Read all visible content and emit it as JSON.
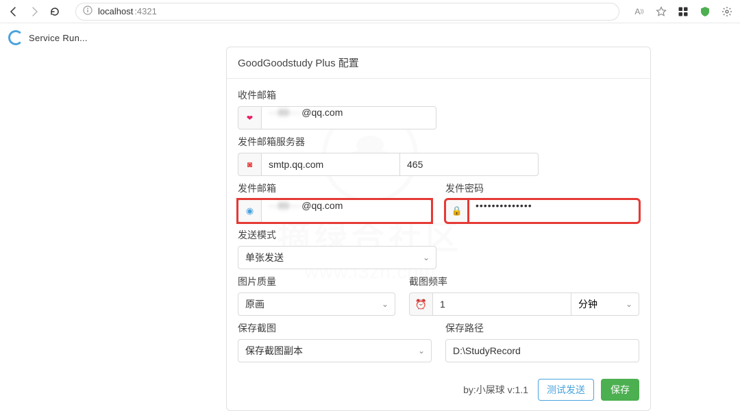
{
  "browser": {
    "url_host": "localhost",
    "url_port": ":4321",
    "tab_title": "Service Run..."
  },
  "card": {
    "title": "GoodGoodstudy Plus 配置",
    "recipient": {
      "label": "收件邮箱",
      "value_prefix": "89",
      "value_suffix": "@qq.com"
    },
    "smtp": {
      "label": "发件邮箱服务器",
      "host": "smtp.qq.com",
      "port": "465"
    },
    "sender": {
      "label": "发件邮箱",
      "value_prefix": "89",
      "value_suffix": "@qq.com"
    },
    "password": {
      "label": "发件密码",
      "value": "••••••••••••••"
    },
    "mode": {
      "label": "发送模式",
      "value": "单张发送"
    },
    "quality": {
      "label": "图片质量",
      "value": "原画"
    },
    "frequency": {
      "label": "截图频率",
      "value": "1",
      "unit": "分钟"
    },
    "keep": {
      "label": "保存截图",
      "value": "保存截图副本"
    },
    "path": {
      "label": "保存路径",
      "value": "D:\\StudyRecord"
    },
    "footer": {
      "credit": "by:小屎球 v:1.1",
      "test_btn": "测试发送",
      "save_btn": "保存"
    }
  },
  "watermark": {
    "line1": "摘绿合社区",
    "line2": "www.i3zh.com"
  }
}
